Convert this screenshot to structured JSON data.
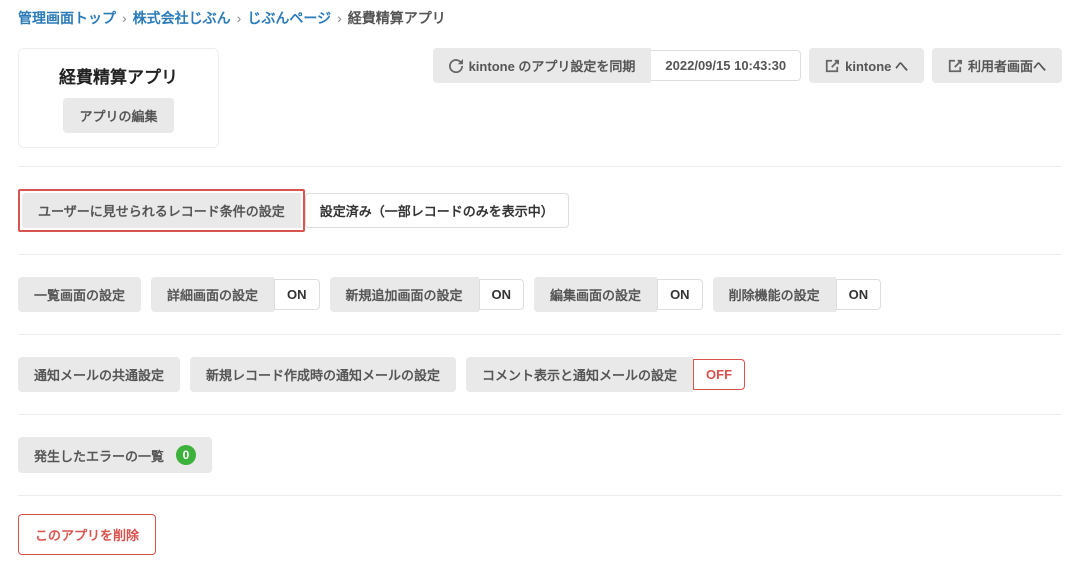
{
  "breadcrumb": {
    "items": [
      {
        "label": "管理画面トップ",
        "href": true
      },
      {
        "label": "株式会社じぶん",
        "href": true
      },
      {
        "label": "じぶんページ",
        "href": true
      }
    ],
    "current": "経費精算アプリ"
  },
  "title_card": {
    "title": "経費精算アプリ",
    "edit_button": "アプリの編集"
  },
  "top_actions": {
    "sync_label": "kintone のアプリ設定を同期",
    "timestamp": "2022/09/15 10:43:30",
    "to_kintone": "kintone へ",
    "to_userscreen": "利用者画面へ"
  },
  "record_condition": {
    "button": "ユーザーに見せられるレコード条件の設定",
    "status": "設定済み（一部レコードのみを表示中）"
  },
  "screens": {
    "list": "一覧画面の設定",
    "detail": {
      "label": "詳細画面の設定",
      "toggle": "ON"
    },
    "add": {
      "label": "新規追加画面の設定",
      "toggle": "ON"
    },
    "edit": {
      "label": "編集画面の設定",
      "toggle": "ON"
    },
    "delete": {
      "label": "削除機能の設定",
      "toggle": "ON"
    }
  },
  "mail": {
    "common": "通知メールの共通設定",
    "new_record": "新規レコード作成時の通知メールの設定",
    "comment": {
      "label": "コメント表示と通知メールの設定",
      "toggle": "OFF"
    }
  },
  "errors": {
    "label": "発生したエラーの一覧",
    "count": "0"
  },
  "delete_app": "このアプリを削除"
}
